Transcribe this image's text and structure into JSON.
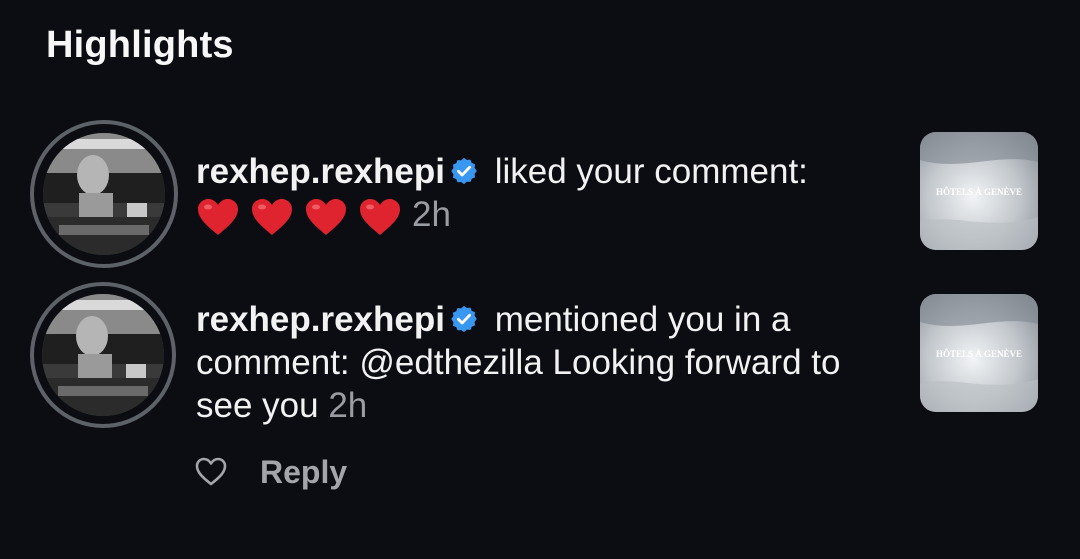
{
  "section": {
    "title": "Highlights"
  },
  "notifications": [
    {
      "username": "rexhep.rexhepi",
      "verified_icon": "verified-badge-icon",
      "action_text": " liked your comment:",
      "hearts": [
        "❤️",
        "❤️",
        "❤️",
        "❤️"
      ],
      "time": "2h",
      "thumbnail_text": "HÔTELS À GENÈVE"
    },
    {
      "username": "rexhep.rexhepi",
      "verified_icon": "verified-badge-icon",
      "action_text": " mentioned you in a comment: @edthezilla Looking forward to see you ",
      "time": "2h",
      "thumbnail_text": "HÔTELS À GENÈVE"
    }
  ],
  "actions": {
    "like_icon": "heart-outline-icon",
    "reply_label": "Reply"
  },
  "colors": {
    "background": "#0c0d12",
    "verified": "#3897f0",
    "heart": "#e0242f",
    "muted_text": "#9a9ca3"
  }
}
